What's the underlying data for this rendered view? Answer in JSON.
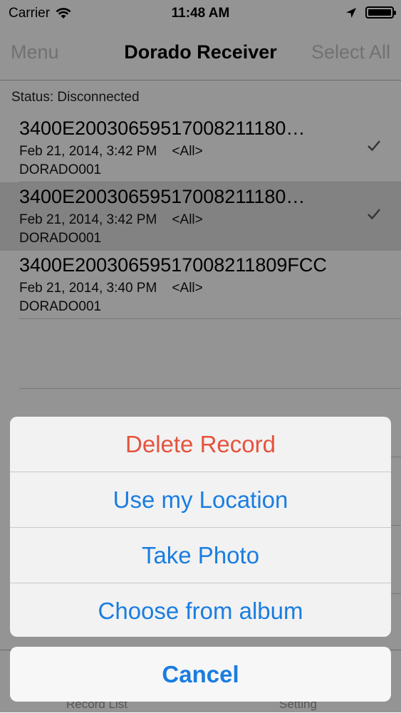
{
  "status_bar": {
    "carrier": "Carrier",
    "time": "11:48 AM",
    "icons": [
      "wifi-icon",
      "location-arrow-icon",
      "battery-icon"
    ]
  },
  "nav": {
    "left": "Menu",
    "title": "Dorado Receiver",
    "right": "Select All"
  },
  "status_text": "Status: Disconnected",
  "records": [
    {
      "title": "3400E20030659517008211180…",
      "date": "Feb 21, 2014, 3:42 PM",
      "filter": "<All>",
      "device": "DORADO001",
      "checked": true,
      "highlighted": false
    },
    {
      "title": "3400E20030659517008211180…",
      "date": "Feb 21, 2014, 3:42 PM",
      "filter": "<All>",
      "device": "DORADO001",
      "checked": true,
      "highlighted": true
    },
    {
      "title": "3400E20030659517008211809FCC",
      "date": "Feb 21, 2014, 3:40 PM",
      "filter": "<All>",
      "device": "DORADO001",
      "checked": false,
      "highlighted": false
    }
  ],
  "tabbar": {
    "left": "Record List",
    "right": "Setting"
  },
  "action_sheet": {
    "buttons": [
      {
        "label": "Delete Record",
        "destructive": true
      },
      {
        "label": "Use my Location",
        "destructive": false
      },
      {
        "label": "Take Photo",
        "destructive": false
      },
      {
        "label": "Choose from album",
        "destructive": false
      }
    ],
    "cancel": "Cancel"
  },
  "colors": {
    "ios_blue": "#1a7de0",
    "destructive_red": "#e5533d",
    "overlay": "rgba(0,0,0,0.40)"
  }
}
